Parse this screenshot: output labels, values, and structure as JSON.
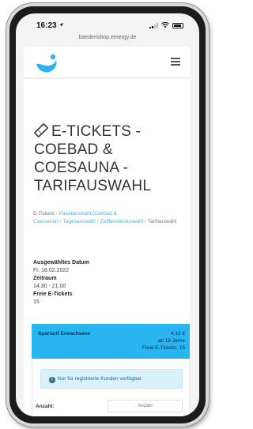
{
  "status_bar": {
    "time": "16:23"
  },
  "browser": {
    "url": "baederishop.emergy.de"
  },
  "site": {
    "brand_color": "#29b6f0"
  },
  "page": {
    "title": "E-TICKETS - COEBAD & COESAUNA - TARIFAUSWAHL"
  },
  "breadcrumb": {
    "items": [
      "E-Tickets",
      "Paketauswahl (Coebad & Coesauna)",
      "Tagesauswahl",
      "Zeitfensterauswahl",
      "Tarifauswahl"
    ]
  },
  "info": {
    "date_label": "Ausgewähltes Datum",
    "date_value": "Fr. 18.02.2022",
    "time_label": "Zeitraum",
    "time_value": "14:30 - 21:00",
    "free_label": "Freie E-Tickets",
    "free_value": "15"
  },
  "tariff": {
    "name": "Spartarif Erwachsene",
    "price": "4,10 €",
    "age": "ab 18 Jahre",
    "free": "Freie E-Tickets: 15",
    "notice": "Nur für registrierte Kunden verfügbar",
    "qty_label": "Anzahl:",
    "qty_placeholder": "Anzahl"
  }
}
